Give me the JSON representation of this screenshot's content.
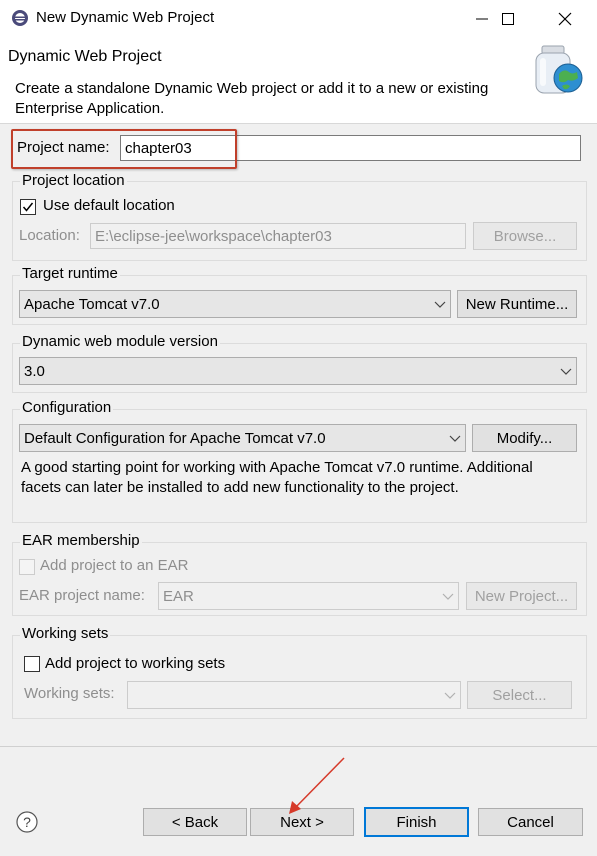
{
  "window": {
    "title": "New Dynamic Web Project"
  },
  "banner": {
    "title": "Dynamic Web Project",
    "description": "Create a standalone Dynamic Web project or add it to a new or existing Enterprise Application."
  },
  "project_name": {
    "label": "Project name:",
    "value": "chapter03"
  },
  "project_location": {
    "group_label": "Project location",
    "use_default_label": "Use default location",
    "use_default_checked": true,
    "location_label": "Location:",
    "location_value": "E:\\eclipse-jee\\workspace\\chapter03",
    "browse_label": "Browse..."
  },
  "target_runtime": {
    "group_label": "Target runtime",
    "selected": "Apache Tomcat v7.0",
    "new_runtime_label": "New Runtime..."
  },
  "module_version": {
    "group_label": "Dynamic web module version",
    "selected": "3.0"
  },
  "configuration": {
    "group_label": "Configuration",
    "selected": "Default Configuration for Apache Tomcat v7.0",
    "modify_label": "Modify...",
    "description": "A good starting point for working with Apache Tomcat v7.0 runtime. Additional facets can later be installed to add new functionality to the project."
  },
  "ear": {
    "group_label": "EAR membership",
    "add_label": "Add project to an EAR",
    "add_checked": false,
    "name_label": "EAR project name:",
    "name_value": "EAR",
    "new_project_label": "New Project..."
  },
  "working_sets": {
    "group_label": "Working sets",
    "add_label": "Add project to working sets",
    "add_checked": false,
    "sets_label": "Working sets:",
    "sets_value": "",
    "select_label": "Select..."
  },
  "footer": {
    "help_icon": "help-icon",
    "back_label": "< Back",
    "next_label": "Next >",
    "finish_label": "Finish",
    "cancel_label": "Cancel"
  },
  "colors": {
    "highlight_box": "#c0402b",
    "arrow": "#d63a2a",
    "default_button_border": "#0078d7"
  }
}
